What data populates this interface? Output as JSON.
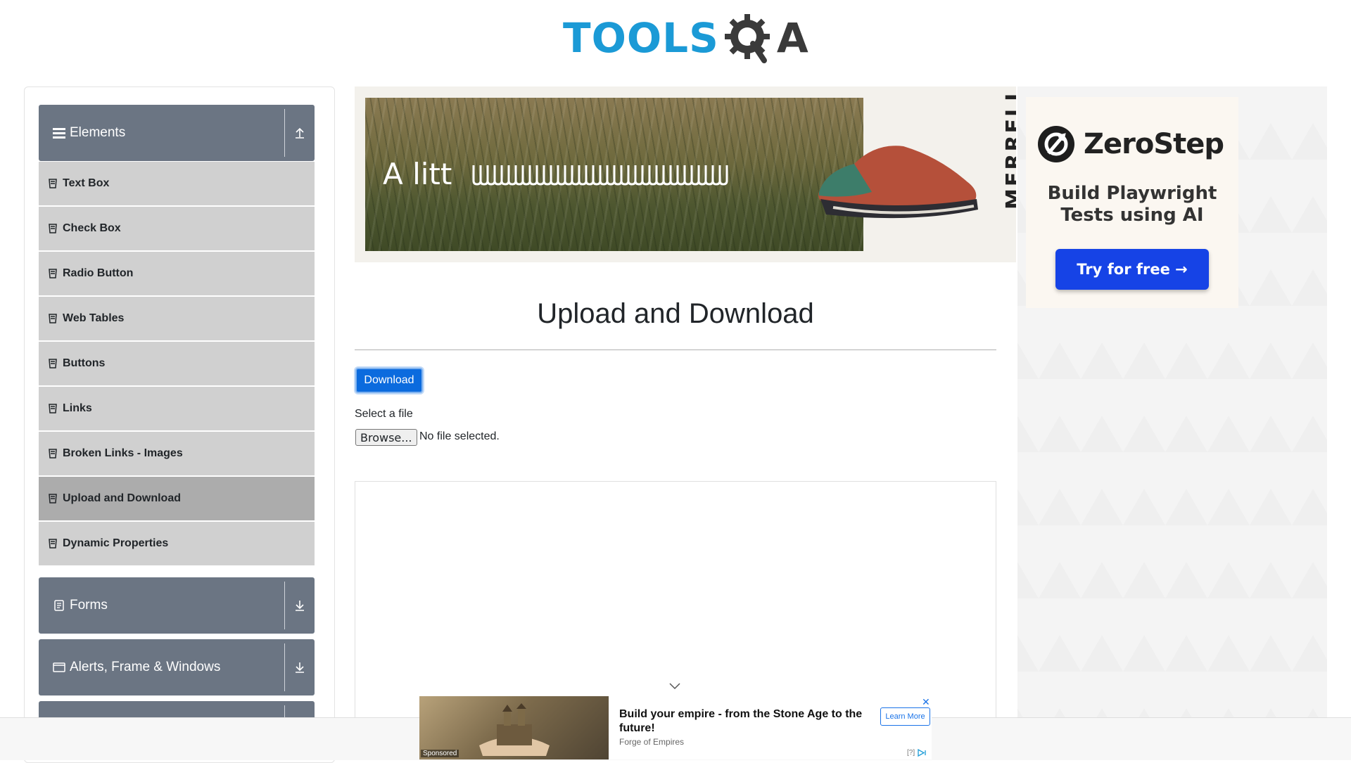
{
  "header": {
    "logo_tools": "TOOLS",
    "logo_qa_a": "A"
  },
  "sidebar": {
    "elements_header": "Elements",
    "items": [
      {
        "label": "Text Box"
      },
      {
        "label": "Check Box"
      },
      {
        "label": "Radio Button"
      },
      {
        "label": "Web Tables"
      },
      {
        "label": "Buttons"
      },
      {
        "label": "Links"
      },
      {
        "label": "Broken Links - Images"
      },
      {
        "label": "Upload and Download",
        "active": true
      },
      {
        "label": "Dynamic Properties"
      }
    ],
    "forms_header": "Forms",
    "alerts_header": "Alerts, Frame & Windows"
  },
  "banner_ad": {
    "text": "A litt",
    "brand": "MERRELL"
  },
  "right_ad": {
    "brand": "ZeroStep",
    "tagline_1": "Build Playwright",
    "tagline_2": "Tests using AI",
    "cta": "Try for free →"
  },
  "main": {
    "title": "Upload and Download",
    "download_label": "Download",
    "select_file_label": "Select a file",
    "browse_label": "Browse...",
    "file_status": "No file selected."
  },
  "sticky_ad": {
    "headline": "Build your empire - from the Stone Age to the future!",
    "advertiser": "Forge of Empires",
    "cta": "Learn More",
    "sponsored": "Sponsored",
    "close": "✕",
    "info": "[?]"
  },
  "colors": {
    "sidebar_header": "#6b7583",
    "menu_item": "#d0d0d0",
    "menu_item_active": "#acacac",
    "primary": "#0b6bde",
    "logo_blue": "#1b9ad6"
  }
}
